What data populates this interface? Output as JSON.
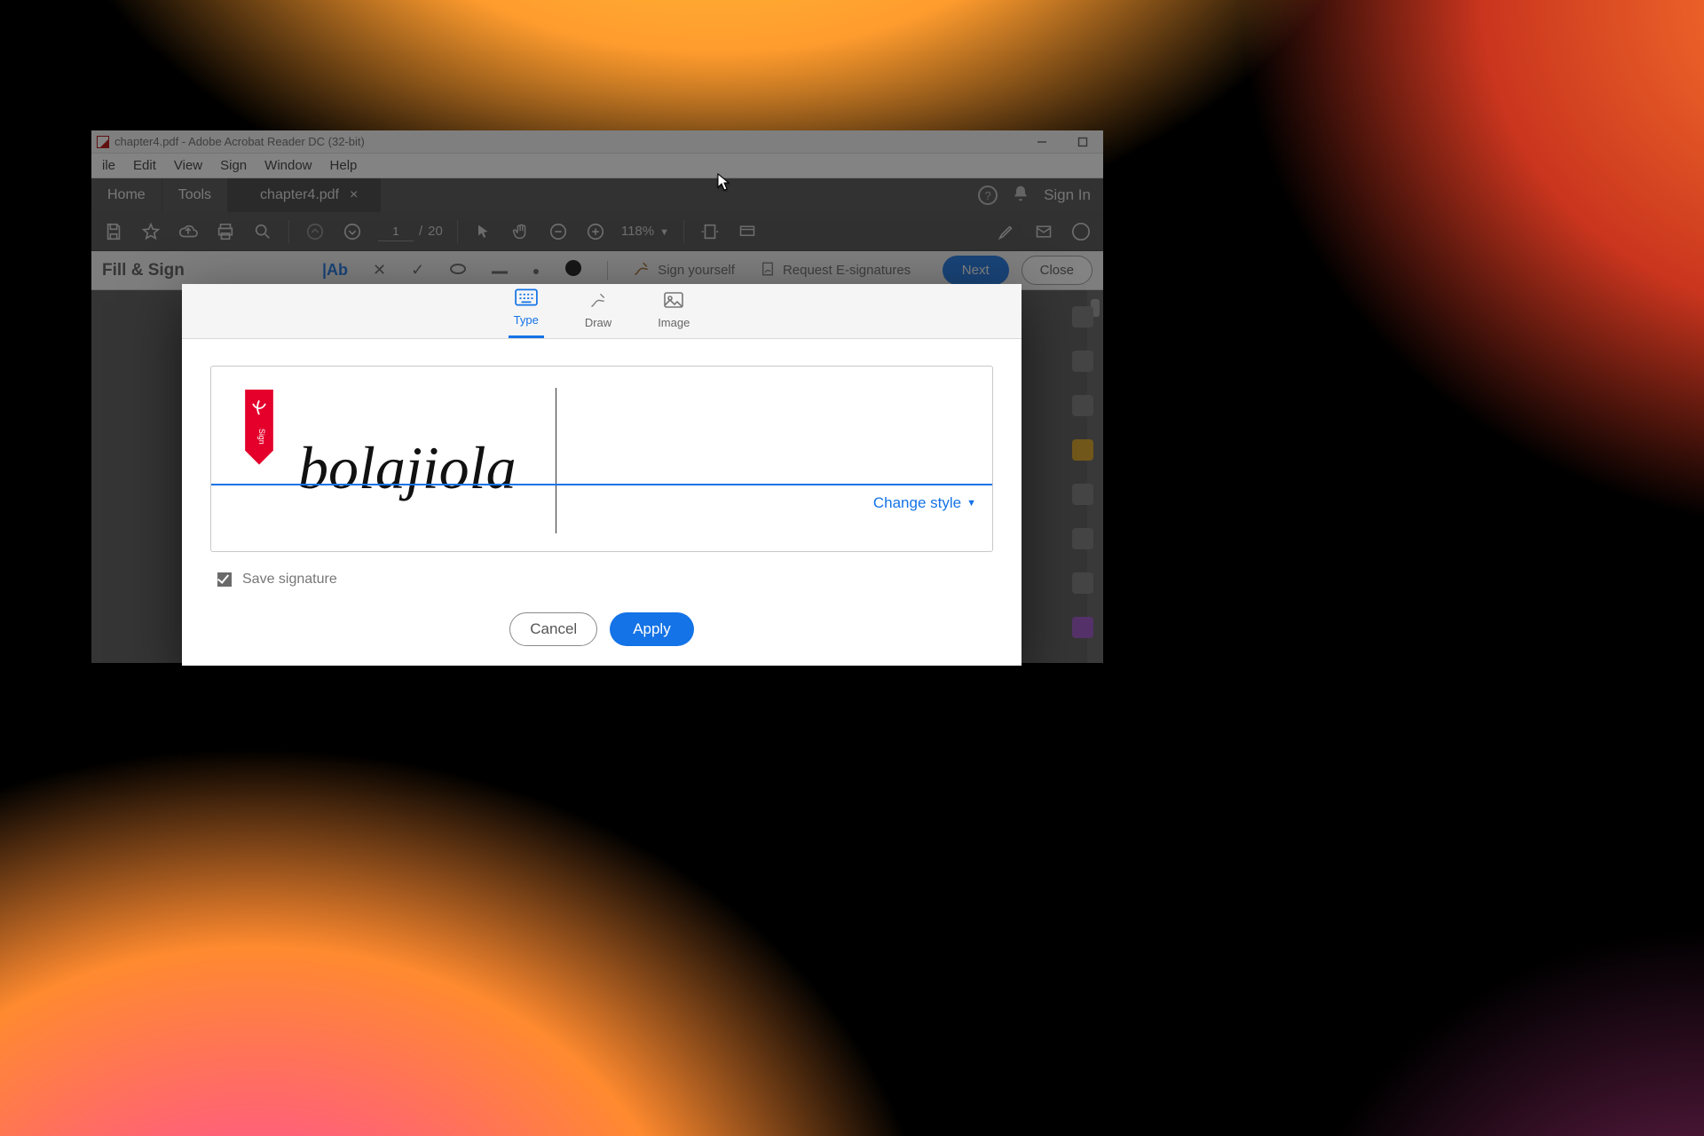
{
  "window": {
    "title": "chapter4.pdf - Adobe Acrobat Reader DC (32-bit)"
  },
  "menubar": [
    "ile",
    "Edit",
    "View",
    "Sign",
    "Window",
    "Help"
  ],
  "tabs": {
    "home": "Home",
    "tools": "Tools",
    "document": "chapter4.pdf",
    "sign_in": "Sign In"
  },
  "toolbar": {
    "page_current": "1",
    "page_total": "20",
    "zoom": "118%"
  },
  "fill_sign": {
    "title": "Fill & Sign",
    "sign_yourself": "Sign yourself",
    "request_esign": "Request E-signatures",
    "next": "Next",
    "close": "Close"
  },
  "signature_modal": {
    "tabs": {
      "type": "Type",
      "draw": "Draw",
      "image": "Image"
    },
    "typed_value": "bolajiola",
    "change_style": "Change style",
    "save_label": "Save signature",
    "save_checked": true,
    "cancel": "Cancel",
    "apply": "Apply"
  }
}
